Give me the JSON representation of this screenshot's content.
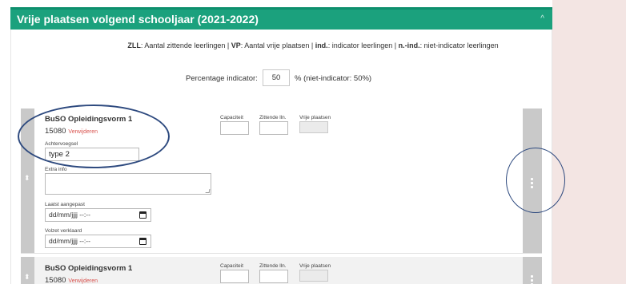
{
  "panel": {
    "title": "Vrije plaatsen volgend schooljaar (2021-2022)",
    "collapse_glyph": "^"
  },
  "legend": {
    "zll_abbr": "ZLL",
    "zll_text": ": Aantal zittende leerlingen | ",
    "vp_abbr": "VP",
    "vp_text": ": Aantal vrije plaatsen | ",
    "ind_abbr": "ind.",
    "ind_text": ": indicator leerlingen | ",
    "nind_abbr": "n.-ind.",
    "nind_text": ": niet-indicator leerlingen"
  },
  "percentage": {
    "label": "Percentage indicator:",
    "value": "50",
    "note": "% (niet-indicator: 50%)"
  },
  "columns": {
    "capacity": "Capaciteit",
    "seated": "Zittende lln.",
    "free": "Vrije plaatsen"
  },
  "rows": [
    {
      "title": "BuSO Opleidingsvorm 1",
      "code": "15080",
      "remove": "Verwijderen",
      "suffix_label": "Achtervoegsel",
      "suffix_value": "type 2",
      "extra_label": "Extra info",
      "last_modified_label": "Laatst aangepast",
      "last_modified_placeholder": "dd/mm/jjjj --:--",
      "full_label": "Volzet verklaard",
      "full_placeholder": "dd/mm/jjjj --:--"
    },
    {
      "title": "BuSO Opleidingsvorm 1",
      "code": "15080",
      "remove": "Verwijderen"
    }
  ],
  "icons": {
    "drag_handle": "up-down-arrows-icon",
    "row_menu": "vertical-dots-icon",
    "calendar": "calendar-icon"
  },
  "colors": {
    "header": "#1ba17d",
    "remove_link": "#d9534f",
    "annotation": "#2e4a7f",
    "side_background": "#f3e5e3"
  }
}
